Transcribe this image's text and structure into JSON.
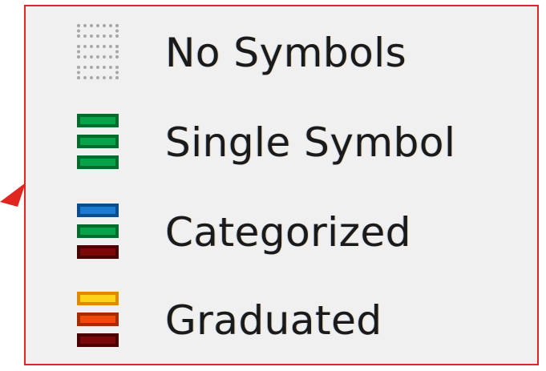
{
  "menu": {
    "items": [
      {
        "label": "No Symbols",
        "icon": "no-symbols-icon",
        "bar_colors": [
          {
            "fill": "transparent",
            "border": "#a8a8a8",
            "style": "dotted"
          },
          {
            "fill": "transparent",
            "border": "#a8a8a8",
            "style": "dotted"
          },
          {
            "fill": "transparent",
            "border": "#a8a8a8",
            "style": "dotted"
          }
        ]
      },
      {
        "label": "Single Symbol",
        "icon": "single-symbol-icon",
        "bar_colors": [
          {
            "fill": "#08a24a",
            "border": "#046b2c",
            "style": "solid"
          },
          {
            "fill": "#08a24a",
            "border": "#046b2c",
            "style": "solid"
          },
          {
            "fill": "#08a24a",
            "border": "#046b2c",
            "style": "solid"
          }
        ]
      },
      {
        "label": "Categorized",
        "icon": "categorized-icon",
        "bar_colors": [
          {
            "fill": "#1a7bd1",
            "border": "#0b4d8c",
            "style": "solid"
          },
          {
            "fill": "#08a24a",
            "border": "#046b2c",
            "style": "solid"
          },
          {
            "fill": "#7a0a0a",
            "border": "#4a0303",
            "style": "solid"
          }
        ]
      },
      {
        "label": "Graduated",
        "icon": "graduated-icon",
        "bar_colors": [
          {
            "fill": "#ffd21a",
            "border": "#e08a00",
            "style": "solid"
          },
          {
            "fill": "#ef4a0c",
            "border": "#a82a00",
            "style": "solid"
          },
          {
            "fill": "#7a0a0a",
            "border": "#4a0303",
            "style": "solid"
          }
        ]
      }
    ]
  },
  "colors": {
    "menu_background": "#f0f0f0",
    "highlight_border": "#e0261f",
    "callout_arrow": "#e0261f"
  }
}
